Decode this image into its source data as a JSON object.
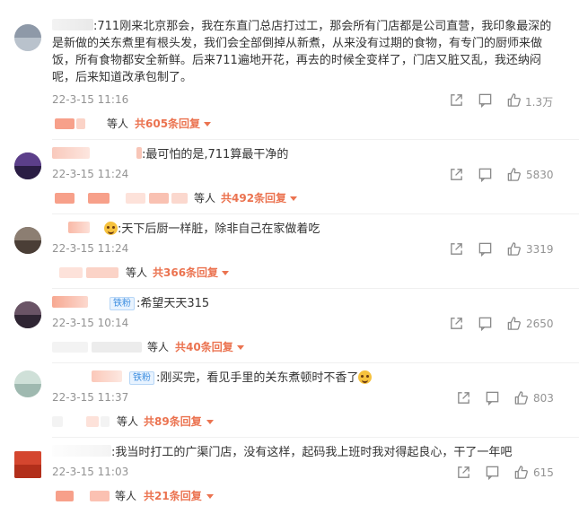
{
  "comments": [
    {
      "text": ":711刚来北京那会，我在东直门总店打过工，那会所有门店都是公司直营，我印象最深的是新做的关东煮里有根头发，我们会全部倒掉从新煮，从来没有过期的食物，有专门的厨师来做饭，所有食物都安全新鲜。后来711遍地开花，再去的时候全变样了，门店又脏又乱，我还纳闷呢，后来知道改承包制了。",
      "time": "22-3-15 11:16",
      "likes": "1.3万",
      "deng": "等人",
      "replies": "共605条回复"
    },
    {
      "text": ":最可怕的是,711算最干净的",
      "time": "22-3-15 11:24",
      "likes": "5830",
      "deng": "等人",
      "replies": "共492条回复"
    },
    {
      "text": ":天下后厨一样脏，除非自己在家做着吃",
      "time": "22-3-15 11:24",
      "likes": "3319",
      "deng": "等人",
      "replies": "共366条回复"
    },
    {
      "badge": "铁粉",
      "text": ":希望天天315",
      "time": "22-3-15 10:14",
      "likes": "2650",
      "deng": "等人",
      "replies": "共40条回复"
    },
    {
      "badge": "铁粉",
      "text": ":刚买完，看见手里的关东煮顿时不香了",
      "time": "22-3-15 11:37",
      "likes": "803",
      "deng": "等人",
      "replies": "共89条回复"
    },
    {
      "text": ":我当时打工的广渠门店，没有这样，起码我上班时我对得起良心，干了一年吧",
      "time": "22-3-15 11:03",
      "likes": "615",
      "deng": "等人",
      "replies": "共21条回复"
    }
  ],
  "colors": {
    "accent": "#eb7350",
    "meta": "#939393",
    "badge_bg": "#e8f3ff",
    "badge_text": "#3f8fe0"
  },
  "icons": [
    "share-icon",
    "comment-icon",
    "like-icon",
    "chevron-down-icon",
    "laughing-emoji-icon"
  ]
}
